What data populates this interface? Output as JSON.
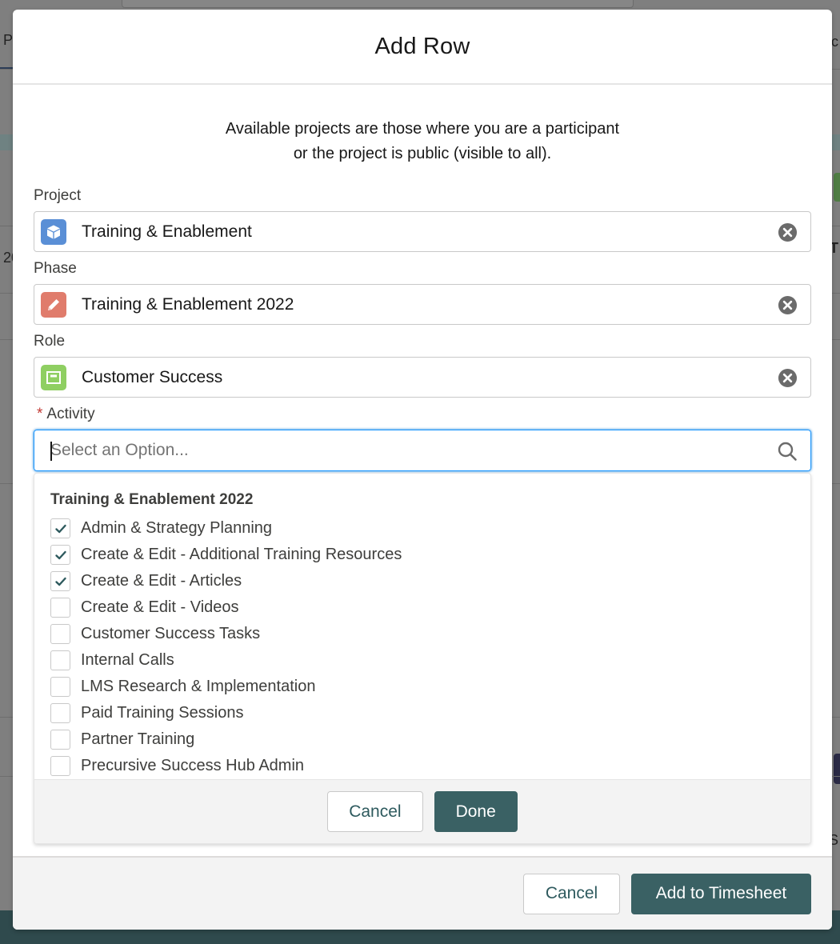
{
  "background": {
    "left_fragments": [
      "P",
      "20"
    ],
    "right_fragments": [
      "c",
      "T",
      "S"
    ]
  },
  "modal": {
    "title": "Add Row",
    "intro_line1": "Available projects are those where you are a participant",
    "intro_line2": "or the project is public (visible to all).",
    "fields": {
      "project": {
        "label": "Project",
        "value": "Training & Enablement",
        "icon": "cube-icon",
        "color": "#5a8fd6"
      },
      "phase": {
        "label": "Phase",
        "value": "Training & Enablement 2022",
        "icon": "pencil-icon",
        "color": "#e07c6c"
      },
      "role": {
        "label": "Role",
        "value": "Customer Success",
        "icon": "window-icon",
        "color": "#8fcf62"
      }
    },
    "activity": {
      "required_marker": "*",
      "label": "Activity",
      "placeholder": "Select an Option...",
      "group_heading": "Training & Enablement 2022",
      "options": [
        {
          "label": "Admin & Strategy Planning",
          "checked": true
        },
        {
          "label": "Create & Edit - Additional Training Resources",
          "checked": true
        },
        {
          "label": "Create & Edit - Articles",
          "checked": true
        },
        {
          "label": "Create & Edit - Videos",
          "checked": false
        },
        {
          "label": "Customer Success Tasks",
          "checked": false
        },
        {
          "label": "Internal Calls",
          "checked": false
        },
        {
          "label": "LMS Research & Implementation",
          "checked": false
        },
        {
          "label": "Paid Training Sessions",
          "checked": false
        },
        {
          "label": "Partner Training",
          "checked": false
        },
        {
          "label": "Precursive Success Hub Admin",
          "checked": false
        }
      ],
      "cancel_label": "Cancel",
      "done_label": "Done"
    },
    "footer": {
      "cancel_label": "Cancel",
      "submit_label": "Add to Timesheet"
    }
  },
  "colors": {
    "brand": "#3a6164",
    "focus": "#1b96ff",
    "required": "#c23934",
    "check": "#2e5a5e"
  }
}
